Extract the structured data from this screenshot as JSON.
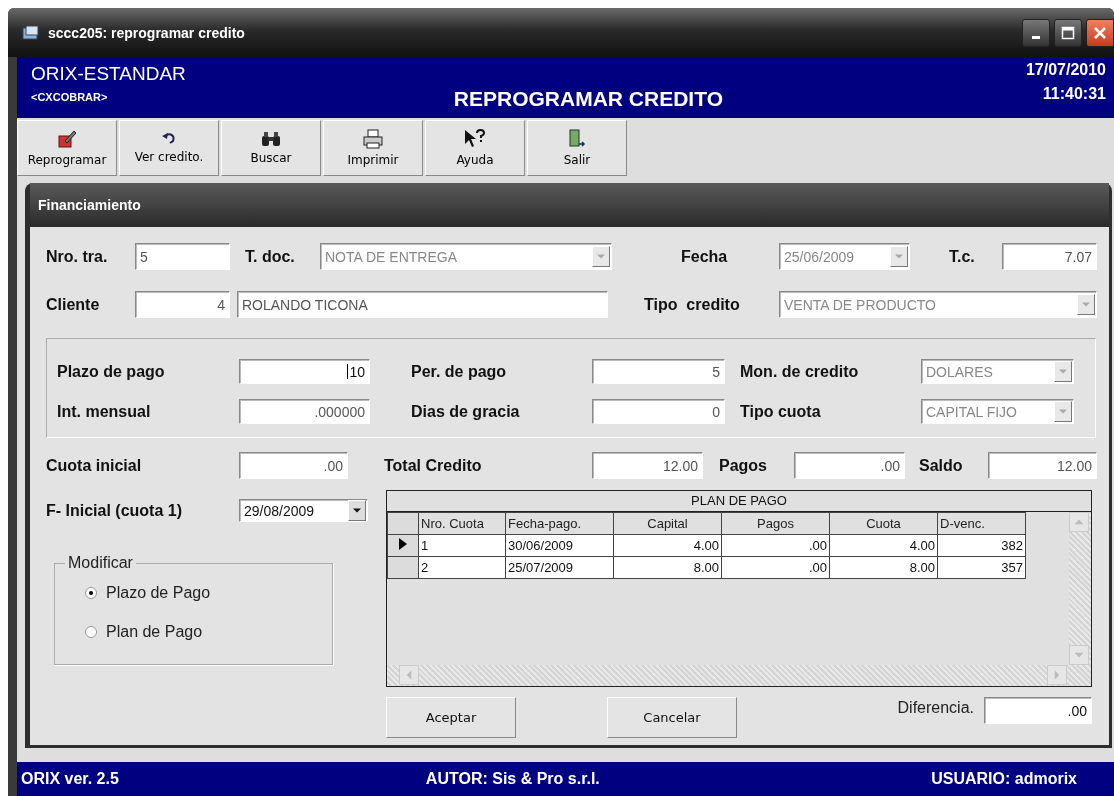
{
  "window": {
    "title": "sccc205: reprogramar credito"
  },
  "header": {
    "company": "ORIX-ESTANDAR",
    "module": "<CXCOBRAR>",
    "title": "REPROGRAMAR CREDITO",
    "date": "17/07/2010",
    "time": "11:40:31"
  },
  "toolbar": [
    {
      "label": "Reprogramar",
      "kind": "edit"
    },
    {
      "label": "Ver credito.",
      "kind": "undo"
    },
    {
      "label": "Buscar",
      "kind": "binoculars"
    },
    {
      "label": "Imprimir",
      "kind": "printer"
    },
    {
      "label": "Ayuda",
      "kind": "help"
    },
    {
      "label": "Salir",
      "kind": "exit"
    }
  ],
  "panel": {
    "title": "Financiamiento"
  },
  "nro_tra": {
    "label": "Nro. tra.",
    "value": "5"
  },
  "t_doc": {
    "label": "T. doc.",
    "value": "NOTA DE ENTREGA",
    "disabled": true
  },
  "fecha": {
    "label": "Fecha",
    "value": "25/06/2009",
    "disabled": true
  },
  "t_c": {
    "label": "T.c.",
    "value": "7.07"
  },
  "cliente": {
    "label": "Cliente",
    "code": "4",
    "name": "ROLANDO TICONA"
  },
  "tipo_credito": {
    "label": "Tipo  credito",
    "value": "VENTA DE PRODUCTO",
    "disabled": true
  },
  "plazo_de_pago": {
    "label": "Plazo de pago",
    "value": "10"
  },
  "per_de_pago": {
    "label": "Per. de pago",
    "value": "5"
  },
  "mon_de_credito": {
    "label": "Mon. de credito",
    "value": "DOLARES",
    "disabled": true
  },
  "int_mensual": {
    "label": "Int. mensual",
    "value": ".000000"
  },
  "dias_de_gracia": {
    "label": "Dias de gracia",
    "value": "0"
  },
  "tipo_cuota": {
    "label": "Tipo cuota",
    "value": "CAPITAL FIJO",
    "disabled": true
  },
  "cuota_inicial": {
    "label": "Cuota inicial",
    "value": ".00"
  },
  "total_credito": {
    "label": "Total Credito",
    "value": "12.00"
  },
  "pagos": {
    "label": "Pagos",
    "value": ".00"
  },
  "saldo": {
    "label": "Saldo",
    "value": "12.00"
  },
  "f_inicial": {
    "label": "F- Inicial (cuota 1)",
    "value": "29/08/2009",
    "disabled": false
  },
  "modificar": {
    "label": "Modificar",
    "options": [
      {
        "label": "Plazo de Pago",
        "selected": true
      },
      {
        "label": "Plan de Pago",
        "selected": false
      }
    ]
  },
  "plan_de_pago": {
    "caption": "PLAN DE PAGO",
    "columns": [
      "Nro. Cuota",
      "Fecha-pago.",
      "Capital",
      "Pagos",
      "Cuota",
      "D-venc."
    ],
    "rows": [
      {
        "selected": true,
        "cells": [
          "1",
          "30/06/2009",
          "4.00",
          ".00",
          "4.00",
          "382"
        ]
      },
      {
        "selected": false,
        "cells": [
          "2",
          "25/07/2009",
          "8.00",
          ".00",
          "8.00",
          "357"
        ]
      }
    ]
  },
  "buttons": [
    "Aceptar",
    "Cancelar"
  ],
  "diferencia": {
    "label": "Diferencia.",
    "value": ".00"
  },
  "status_bar": [
    "ORIX ver. 2.5",
    "AUTOR: Sis & Pro s.r.l.",
    "USUARIO: admorix"
  ]
}
